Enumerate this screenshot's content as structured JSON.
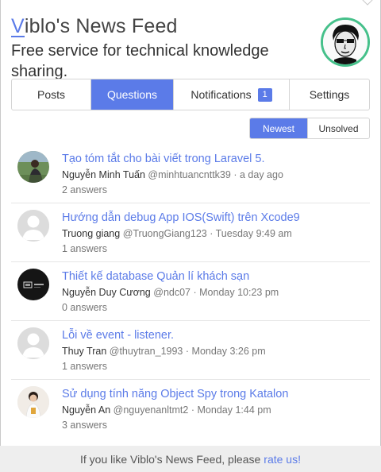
{
  "header": {
    "title_first_letter": "V",
    "title_rest": "iblo's News Feed",
    "tagline": "Free service for technical knowledge sharing."
  },
  "tabs": [
    {
      "label": "Posts",
      "active": false
    },
    {
      "label": "Questions",
      "active": true
    },
    {
      "label": "Notifications",
      "active": false,
      "badge": "1"
    },
    {
      "label": "Settings",
      "active": false
    }
  ],
  "filters": [
    {
      "label": "Newest",
      "active": true
    },
    {
      "label": "Unsolved",
      "active": false
    }
  ],
  "questions": [
    {
      "title": "Tạo tóm tắt cho bài viết trong Laravel 5.",
      "author": "Nguyễn Minh Tuấn",
      "handle": "@minhtuancnttk39",
      "time": "a day ago",
      "answers": "2 answers",
      "avatar": "photo-outdoor"
    },
    {
      "title": "Hướng dẫn debug App IOS(Swift) trên Xcode9",
      "author": "Truong giang",
      "handle": "@TruongGiang123",
      "time": "Tuesday 9:49 am",
      "answers": "1 answers",
      "avatar": "default-user"
    },
    {
      "title": "Thiết kế database Quản lí khách sạn",
      "author": "Nguyễn Duy Cương",
      "handle": "@ndc07",
      "time": "Monday 10:23 pm",
      "answers": "0 answers",
      "avatar": "dark-logo"
    },
    {
      "title": "Lỗi về event - listener.",
      "author": "Thuy Tran",
      "handle": "@thuytran_1993",
      "time": "Monday 3:26 pm",
      "answers": "1 answers",
      "avatar": "default-user"
    },
    {
      "title": "Sử dụng tính năng Object Spy trong Katalon",
      "author": "Nguyễn An",
      "handle": "@nguyenanltmt2",
      "time": "Monday 1:44 pm",
      "answers": "3 answers",
      "avatar": "photo-person"
    }
  ],
  "meta_separator": "·",
  "footer": {
    "text": "If you like Viblo's News Feed, please",
    "link": "rate us!"
  },
  "colors": {
    "accent": "#5b7be8",
    "avatar_ring": "#45c08a",
    "footer_bg": "#eeeeee"
  }
}
